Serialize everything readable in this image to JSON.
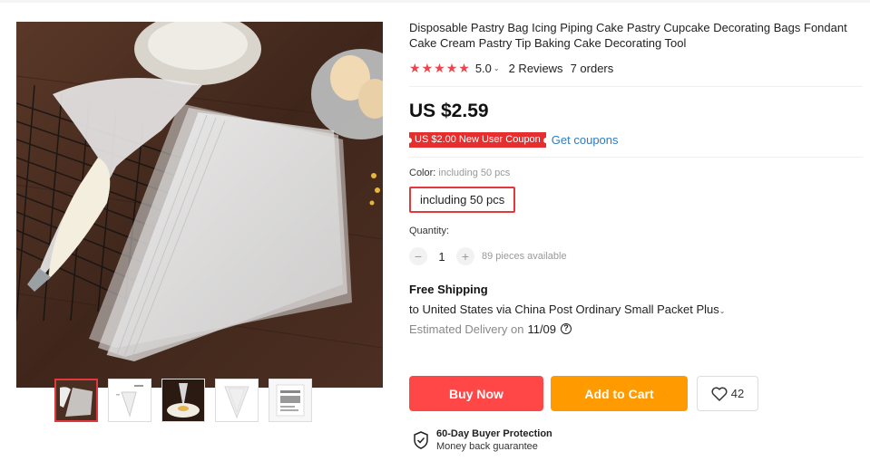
{
  "product": {
    "title": "Disposable Pastry Bag Icing Piping Cake Pastry Cupcake Decorating Bags Fondant Cake Cream Pastry Tip Baking Cake Decorating Tool",
    "rating_value": "5.0",
    "rating_caret": "⌄",
    "reviews": "2 Reviews",
    "orders": "7 orders",
    "price": "US $2.59"
  },
  "coupon": {
    "badge": "US $2.00 New User Coupon",
    "link": "Get coupons"
  },
  "color": {
    "label": "Color: ",
    "selected": "including 50 pcs",
    "option": "including 50 pcs"
  },
  "quantity": {
    "label": "Quantity:",
    "value": "1",
    "minus": "−",
    "plus": "+",
    "available": "89 pieces available"
  },
  "shipping": {
    "title": "Free Shipping",
    "line": "to United States via China Post Ordinary Small Packet Plus",
    "caret": "⌄",
    "estimated_label": "Estimated Delivery on",
    "estimated_date": "11/09",
    "help": "?"
  },
  "actions": {
    "buy_now": "Buy Now",
    "add_to_cart": "Add to Cart",
    "wishlist_count": "42"
  },
  "protection": {
    "title": "60-Day Buyer Protection",
    "subtitle": "Money back guarantee"
  },
  "colors": {
    "accent_red": "#ff4747",
    "cart_orange": "#ff9a00",
    "star_red": "#f0434b",
    "link_blue": "#2e7bbf"
  },
  "icons": {
    "star": "★",
    "heart": "heart-icon",
    "shield": "shield-check-icon"
  }
}
